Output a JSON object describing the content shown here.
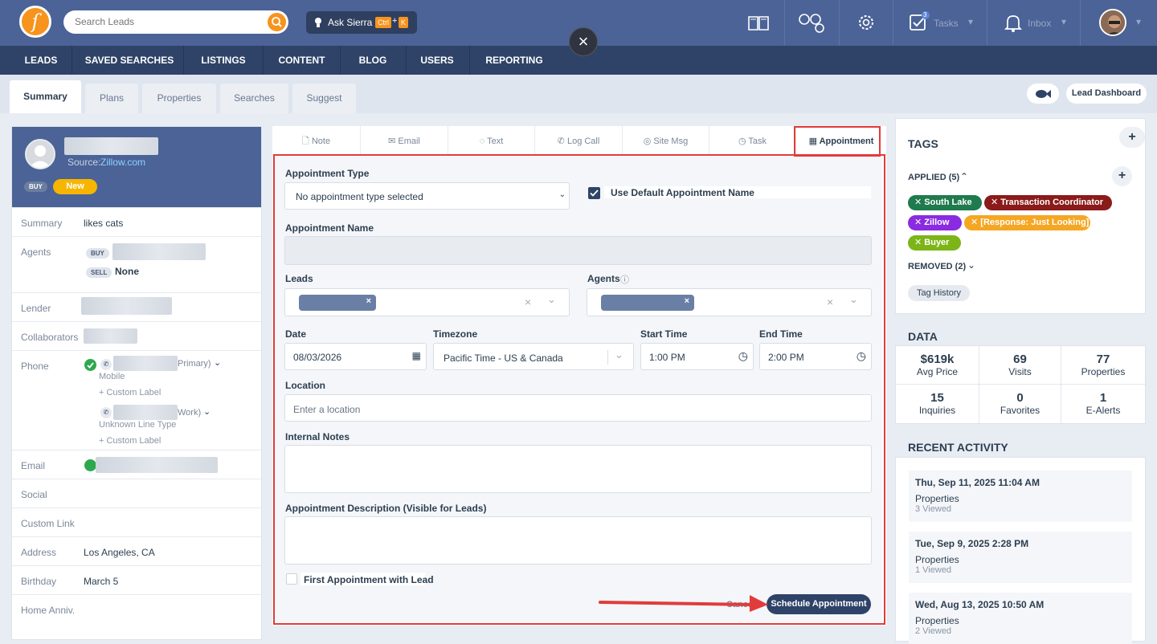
{
  "header": {
    "search_placeholder": "Search Leads",
    "ask_label": "Ask Sierra",
    "kbd_ctrl": "Ctrl",
    "kbd_plus": "+",
    "kbd_k": "K",
    "tasks_label": "Tasks",
    "tasks_count": "3",
    "inbox_label": "Inbox",
    "close_glyph": "×"
  },
  "nav": [
    "LEADS",
    "SAVED SEARCHES",
    "LISTINGS",
    "CONTENT",
    "BLOG",
    "USERS",
    "REPORTING"
  ],
  "subtabs": [
    "Summary",
    "Plans",
    "Properties",
    "Searches",
    "Suggest"
  ],
  "lead_dashboard_label": "Lead Dashboard",
  "profile": {
    "source_label": "Source:",
    "source_value": "Zillow.com",
    "badge_buy": "BUY",
    "badge_new": "New"
  },
  "details": {
    "summary_label": "Summary",
    "summary_value": "likes cats",
    "agents_label": "Agents",
    "agent_buy": "BUY",
    "agent_sell": "SELL",
    "agent_sell_value": "None",
    "lender_label": "Lender",
    "collab_label": "Collaborators",
    "phone_label": "Phone",
    "phone1_suffix": "Primary)",
    "phone1_type": "Mobile",
    "phone1_custom": "+ Custom Label",
    "phone2_suffix": "Work)",
    "phone2_type": "Unknown Line Type",
    "phone2_custom": "+ Custom Label",
    "email_label": "Email",
    "social_label": "Social",
    "custom_link_label": "Custom Link",
    "address_label": "Address",
    "address_value": "Los Angeles, CA",
    "birthday_label": "Birthday",
    "birthday_value": "March 5",
    "home_anniv_label": "Home Anniv."
  },
  "action_tabs": [
    "Note",
    "Email",
    "Text",
    "Log Call",
    "Site Msg",
    "Task",
    "Appointment"
  ],
  "form": {
    "type_label": "Appointment Type",
    "type_value": "No appointment type selected",
    "use_default_label": "Use Default Appointment Name",
    "name_label": "Appointment Name",
    "leads_label": "Leads",
    "agents_label": "Agents",
    "date_label": "Date",
    "date_value": "08/03/2026",
    "timezone_label": "Timezone",
    "timezone_value": "Pacific Time - US & Canada",
    "start_label": "Start Time",
    "start_value": "1:00 PM",
    "end_label": "End Time",
    "end_value": "2:00 PM",
    "location_label": "Location",
    "location_placeholder": "Enter a location",
    "notes_label": "Internal Notes",
    "desc_label": "Appointment Description (Visible for Leads)",
    "first_label": "First Appointment with Lead",
    "cancel_label": "Cancel",
    "submit_label": "Schedule Appointment"
  },
  "tags": {
    "title": "TAGS",
    "applied_label": "APPLIED (5)",
    "removed_label": "REMOVED (2)",
    "history_label": "Tag History",
    "items": [
      {
        "label": "South Lake",
        "color": "#1f7a4d"
      },
      {
        "label": "Transaction Coordinator",
        "color": "#8b1a1a"
      },
      {
        "label": "Zillow",
        "color": "#8a2be2"
      },
      {
        "label": "[Response: Just Looking]",
        "color": "#f5a623"
      },
      {
        "label": "Buyer",
        "color": "#7cb518"
      }
    ]
  },
  "data": {
    "title": "DATA",
    "cells": [
      {
        "value": "$619k",
        "label": "Avg Price"
      },
      {
        "value": "69",
        "label": "Visits"
      },
      {
        "value": "77",
        "label": "Properties"
      },
      {
        "value": "15",
        "label": "Inquiries"
      },
      {
        "value": "0",
        "label": "Favorites"
      },
      {
        "value": "1",
        "label": "E-Alerts"
      }
    ]
  },
  "activity": {
    "title": "RECENT ACTIVITY",
    "items": [
      {
        "date": "Thu, Sep 11, 2025 11:04 AM",
        "type": "Properties",
        "detail": "3 Viewed"
      },
      {
        "date": "Tue, Sep 9, 2025 2:28 PM",
        "type": "Properties",
        "detail": "1 Viewed"
      },
      {
        "date": "Wed, Aug 13, 2025 10:50 AM",
        "type": "Properties",
        "detail": "2 Viewed"
      }
    ]
  }
}
